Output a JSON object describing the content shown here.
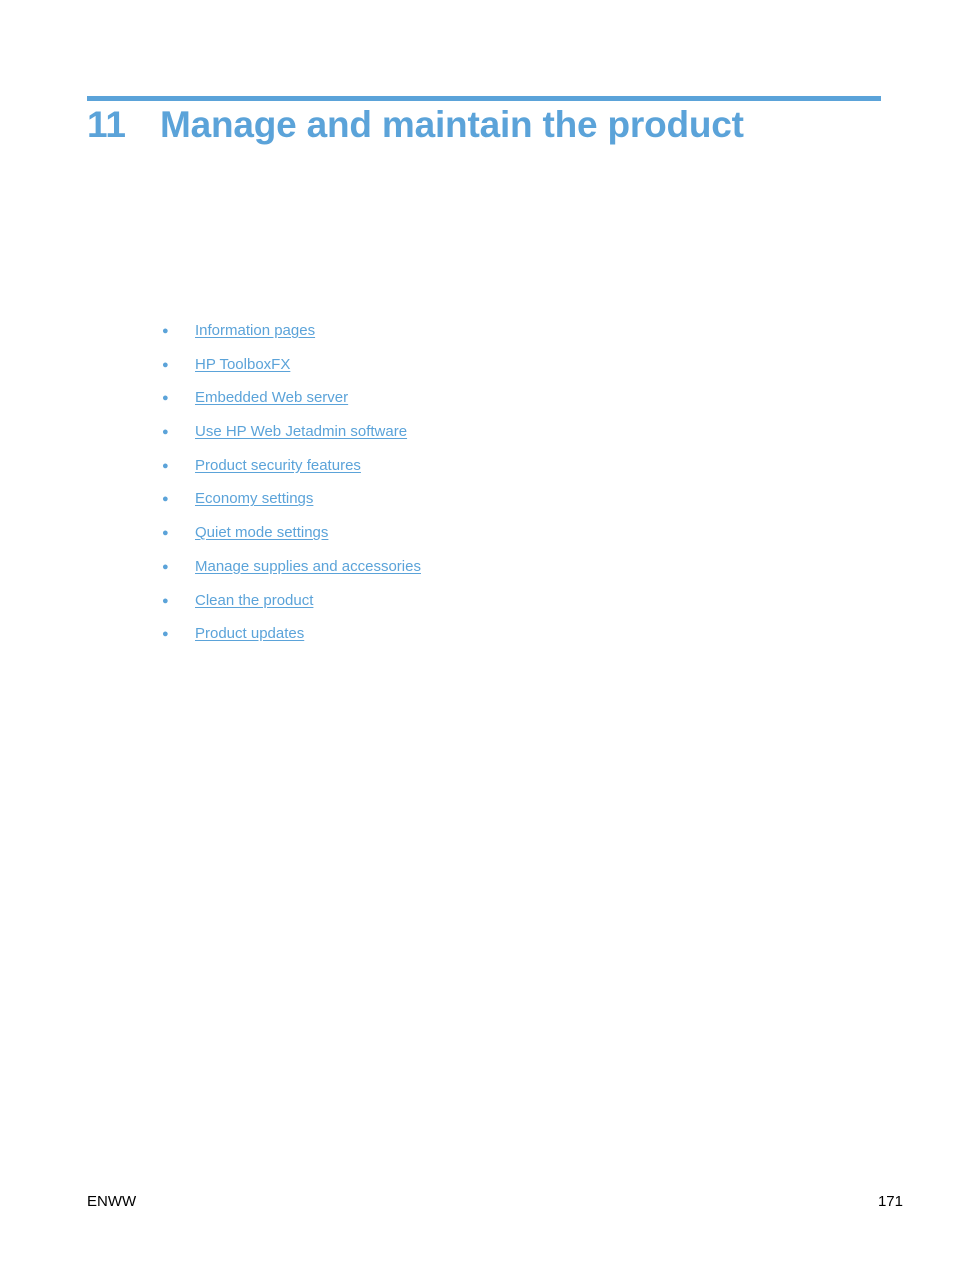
{
  "chapter": {
    "number": "11",
    "title": "Manage and maintain the product",
    "accent_color": "#5ba3d9"
  },
  "toc": {
    "bullet_icon": "●",
    "items": [
      {
        "label": "Information pages"
      },
      {
        "label": "HP ToolboxFX"
      },
      {
        "label": "Embedded Web server"
      },
      {
        "label": "Use HP Web Jetadmin software"
      },
      {
        "label": "Product security features"
      },
      {
        "label": "Economy settings"
      },
      {
        "label": "Quiet mode settings"
      },
      {
        "label": "Manage supplies and accessories"
      },
      {
        "label": "Clean the product"
      },
      {
        "label": "Product updates"
      }
    ]
  },
  "footer": {
    "left": "ENWW",
    "page_number": "171"
  }
}
